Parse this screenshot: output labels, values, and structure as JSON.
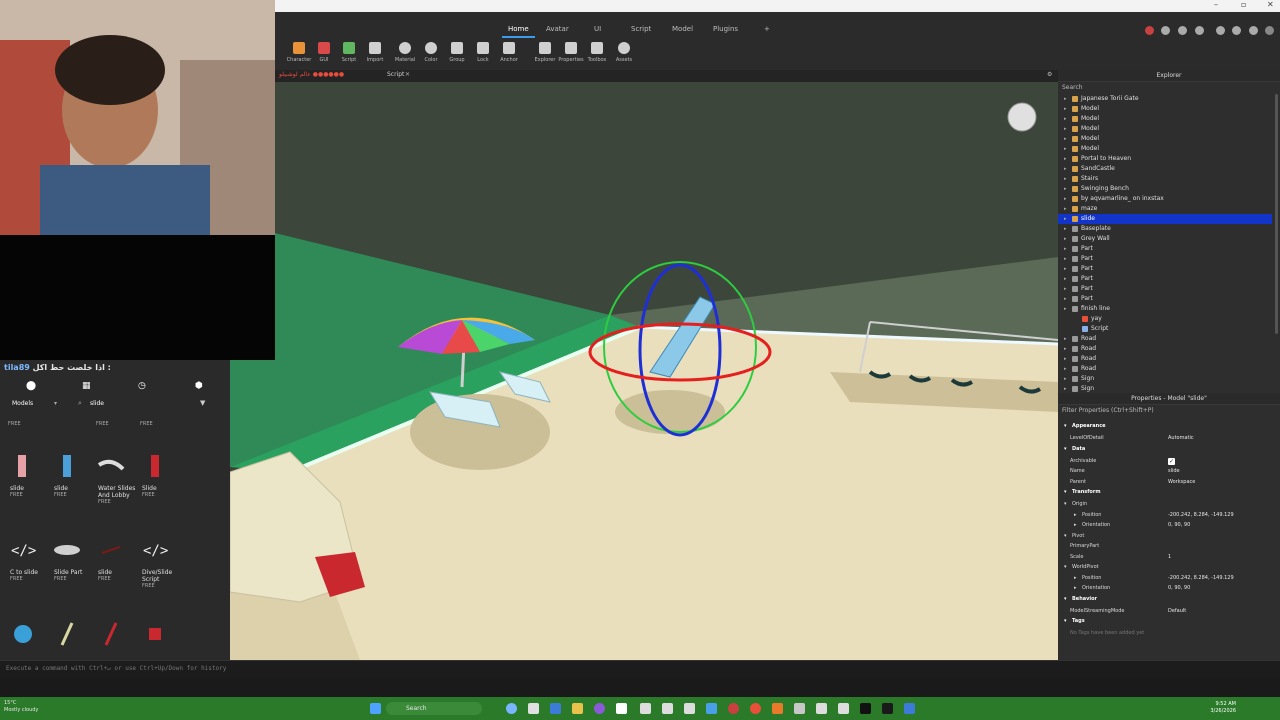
{
  "menu": {
    "tabs": [
      "Home",
      "Avatar",
      "UI",
      "Script",
      "Model",
      "Plugins",
      "+"
    ]
  },
  "toolbar": {
    "tools": [
      "Character",
      "GUI",
      "Script",
      "Import",
      "Material",
      "Color",
      "Group",
      "Lock",
      "Anchor",
      "Explorer",
      "Properties",
      "Toolbox",
      "Assets"
    ]
  },
  "doc_tabs": {
    "place_tab": "عالم لوشبيلو ●●●●●●",
    "script_tab": "Script"
  },
  "overlay": {
    "username": "tila89",
    "message": "اذا خلصت حط اكل :"
  },
  "toolbox": {
    "category": "Models",
    "search_value": "slide",
    "items": [
      {
        "name": "slide",
        "price": "FREE"
      },
      {
        "name": "slide",
        "price": "FREE"
      },
      {
        "name": "Water Slides And Lobby",
        "price": "FREE"
      },
      {
        "name": "Slide",
        "price": "FREE"
      },
      {
        "name": "C to slide",
        "price": "FREE"
      },
      {
        "name": "Slide Part",
        "price": "FREE"
      },
      {
        "name": "slide",
        "price": "FREE"
      },
      {
        "name": "Dive/Slide Script",
        "price": "FREE"
      }
    ],
    "top_prices": [
      "FREE",
      "FREE",
      "FREE"
    ]
  },
  "explorer": {
    "title": "Explorer",
    "search_placeholder": "Search",
    "items": [
      {
        "label": "Japanese Torii Gate",
        "indent": 1,
        "icon": "model"
      },
      {
        "label": "Model",
        "indent": 1,
        "icon": "model"
      },
      {
        "label": "Model",
        "indent": 1,
        "icon": "model"
      },
      {
        "label": "Model",
        "indent": 1,
        "icon": "model"
      },
      {
        "label": "Model",
        "indent": 1,
        "icon": "model"
      },
      {
        "label": "Model",
        "indent": 1,
        "icon": "model"
      },
      {
        "label": "Portal to Heaven",
        "indent": 1,
        "icon": "model"
      },
      {
        "label": "SandCastle",
        "indent": 1,
        "icon": "model"
      },
      {
        "label": "Stairs",
        "indent": 1,
        "icon": "model"
      },
      {
        "label": "Swinging Bench",
        "indent": 1,
        "icon": "model"
      },
      {
        "label": "by aqvamarline_ on inxstax",
        "indent": 1,
        "icon": "model"
      },
      {
        "label": "maze",
        "indent": 1,
        "icon": "model"
      },
      {
        "label": "slide",
        "indent": 1,
        "icon": "model",
        "selected": true
      },
      {
        "label": "Baseplate",
        "indent": 1,
        "icon": "part"
      },
      {
        "label": "Grey Wall",
        "indent": 1,
        "icon": "part"
      },
      {
        "label": "Part",
        "indent": 1,
        "icon": "part"
      },
      {
        "label": "Part",
        "indent": 1,
        "icon": "part"
      },
      {
        "label": "Part",
        "indent": 1,
        "icon": "part"
      },
      {
        "label": "Part",
        "indent": 1,
        "icon": "part"
      },
      {
        "label": "Part",
        "indent": 1,
        "icon": "part"
      },
      {
        "label": "Part",
        "indent": 1,
        "icon": "part"
      },
      {
        "label": "finish line",
        "indent": 1,
        "icon": "part"
      },
      {
        "label": "yay",
        "indent": 2,
        "icon": "fire"
      },
      {
        "label": "Script",
        "indent": 2,
        "icon": "script"
      },
      {
        "label": "Road",
        "indent": 1,
        "icon": "part"
      },
      {
        "label": "Road",
        "indent": 1,
        "icon": "part"
      },
      {
        "label": "Road",
        "indent": 1,
        "icon": "part"
      },
      {
        "label": "Road",
        "indent": 1,
        "icon": "part"
      },
      {
        "label": "Sign",
        "indent": 1,
        "icon": "part"
      },
      {
        "label": "Sign",
        "indent": 1,
        "icon": "part"
      }
    ]
  },
  "properties": {
    "title": "Properties - Model \"slide\"",
    "filter_placeholder": "Filter Properties (Ctrl+Shift+P)",
    "rows": [
      {
        "type": "section",
        "label": "Appearance"
      },
      {
        "label": "LevelOfDetail",
        "value": "Automatic"
      },
      {
        "type": "section",
        "label": "Data"
      },
      {
        "label": "Archivable",
        "value": "",
        "check": true
      },
      {
        "label": "Name",
        "value": "slide"
      },
      {
        "label": "Parent",
        "value": "Workspace"
      },
      {
        "type": "section",
        "label": "Transform"
      },
      {
        "type": "sub",
        "label": "Origin"
      },
      {
        "label": "Position",
        "value": "-200.242, 8.284, -149.129",
        "expand": true
      },
      {
        "label": "Orientation",
        "value": "0, 90, 90",
        "expand": true
      },
      {
        "type": "sub",
        "label": "Pivot"
      },
      {
        "label": "PrimaryPart",
        "value": ""
      },
      {
        "label": "Scale",
        "value": "1"
      },
      {
        "type": "sub",
        "label": "WorldPivot"
      },
      {
        "label": "Position",
        "value": "-200.242, 8.284, -149.129",
        "expand": true
      },
      {
        "label": "Orientation",
        "value": "0, 90, 90",
        "expand": true
      },
      {
        "type": "section",
        "label": "Behavior"
      },
      {
        "label": "ModelStreamingMode",
        "value": "Default"
      },
      {
        "type": "section",
        "label": "Tags"
      },
      {
        "label": "No Tags have been added yet",
        "value": "",
        "muted": true
      }
    ]
  },
  "command_bar": {
    "placeholder": "Execute a command with Ctrl+↵ or use Ctrl+Up/Down for history"
  },
  "taskbar": {
    "weather_temp": "15°C",
    "weather_desc": "Mostly cloudy",
    "search_label": "Search",
    "time": "9:52 AM",
    "date": "3/26/2026"
  },
  "colors": {
    "accent": "#3d9be9",
    "selection": "#1334c8",
    "taskbar": "#2a7a2a"
  }
}
